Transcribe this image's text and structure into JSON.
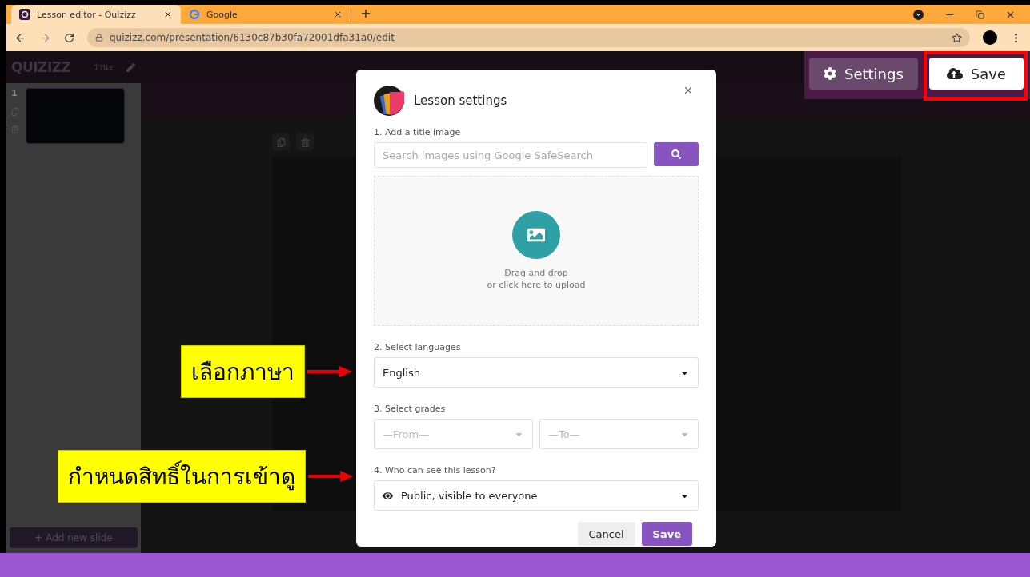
{
  "browser": {
    "tabs": [
      {
        "title": "Lesson editor - Quizizz",
        "kind": "quizizz",
        "selected": true
      },
      {
        "title": "Google",
        "kind": "google",
        "selected": false
      }
    ],
    "url": "quizizz.com/presentation/6130c87b30fa72001dfa31a0/edit"
  },
  "editor": {
    "logo": "QUIZIZZ",
    "title": "ว่านะ",
    "settings_button": "Settings",
    "save_button": "Save",
    "save_highlighted": true,
    "slides": [
      {
        "number": "1"
      }
    ],
    "add_slide": "+ Add new slide"
  },
  "dialog": {
    "title": "Lesson settings",
    "image_label": "1. Add a title image",
    "search": {
      "placeholder": "Search images using Google SafeSearch"
    },
    "drop_text": [
      "Drag and drop",
      "or click here to upload"
    ],
    "language_label": "2. Select languages",
    "language": "English",
    "grades_label": "3. Select grades",
    "grade_from": "—From—",
    "grade_to": "—To—",
    "visibility_label": "4. Who can see this lesson?",
    "visibility": "Public, visible to everyone",
    "buttons": [
      {
        "label": "Cancel",
        "kind": "secondary"
      },
      {
        "label": "Save",
        "kind": "primary"
      }
    ]
  },
  "annotations": [
    {
      "text": "เลือกภาษา"
    },
    {
      "text": "กำหนดสิทธิ์ในการเข้าดู"
    }
  ]
}
